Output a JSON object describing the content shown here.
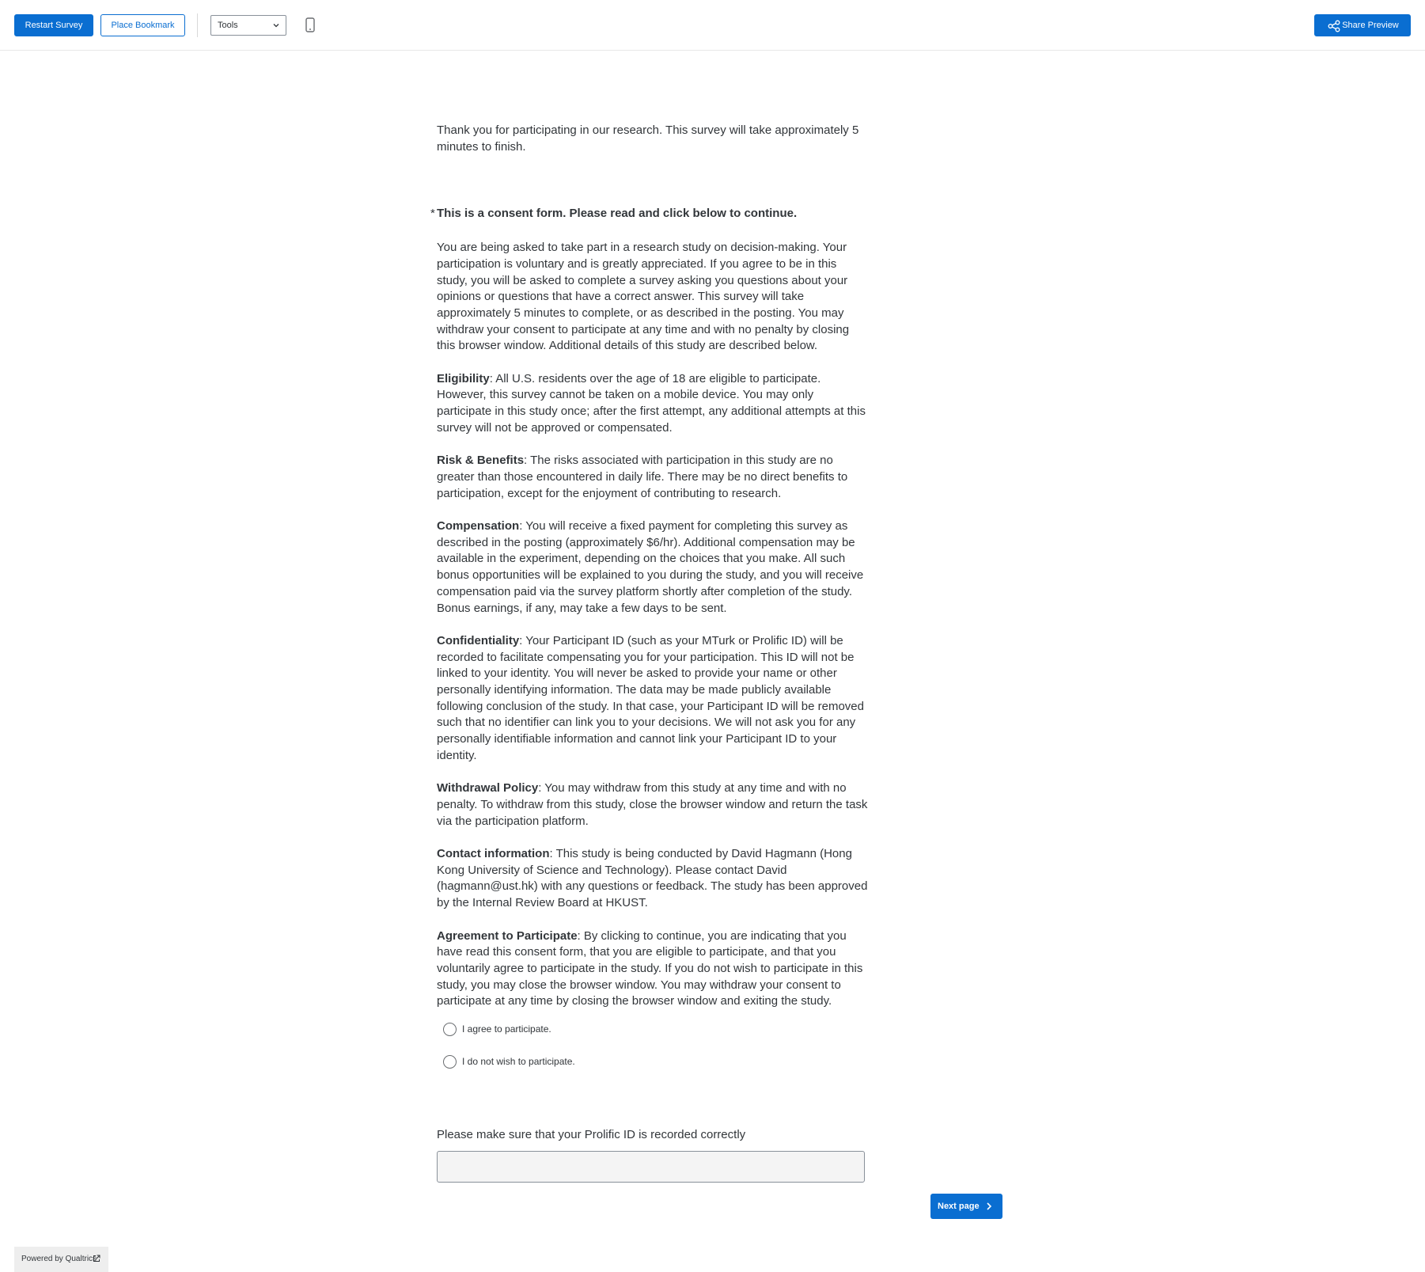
{
  "toolbar": {
    "restart_label": "Restart Survey",
    "bookmark_label": "Place Bookmark",
    "tools_selected": "Tools",
    "share_label": "Share Preview",
    "icons": {
      "mobile": "mobile-phone-icon",
      "share": "share-icon",
      "dropdown": "chevron-down-icon"
    }
  },
  "intro": {
    "text": "Thank you for participating in our research. This survey will take approximately 5 minutes to finish."
  },
  "consent": {
    "required_marker": "*",
    "title": "This is a consent form. Please read and click below to continue.",
    "paragraph_1": "You are being asked to take part in a research study on decision-making. Your participation is voluntary and is greatly appreciated. If you agree to be in this study, you will be asked to complete a survey asking you questions about your opinions or questions that have a correct answer. This survey will take approximately 5 minutes to complete, or as described in the posting. You may withdraw your consent to participate at any time and with no penalty by closing this browser window. Additional details of this study are described below.",
    "sections": [
      {
        "heading": "Eligibility",
        "text": ": All U.S. residents over the age of 18 are eligible to participate. However, this survey cannot be taken on a mobile device. You may only participate in this study once; after the first attempt, any additional attempts at this survey will not be approved or compensated."
      },
      {
        "heading": "Risk & Benefits",
        "text": ": The risks associated with participation in this study are no greater than those encountered in daily life. There may be no direct benefits to participation, except for the enjoyment of contributing to research."
      },
      {
        "heading": "Compensation",
        "text": ": You will receive a fixed payment for completing this survey as described in the posting (approximately $6/hr). Additional compensation may be available in the experiment, depending on the choices that you make. All such bonus opportunities will be explained to you during the study, and you will receive compensation paid via the survey platform shortly after completion of the study. Bonus earnings, if any, may take a few days to be sent."
      },
      {
        "heading": "Confidentiality",
        "text": ": Your Participant ID (such as your MTurk or Prolific ID) will be recorded to facilitate compensating you for your participation. This ID will not be linked to your identity. You will never be asked to provide your name or other personally identifying information. The data may be made publicly available following conclusion of the study. In that case, your Participant ID will be removed such that no identifier can link you to your decisions. We will not ask you for any personally identifiable information and cannot link your Participant ID to your identity."
      },
      {
        "heading": "Withdrawal Policy",
        "text": ": You may withdraw from this study at any time and with no penalty. To withdraw from this study, close the browser window and return the task via the participation platform."
      },
      {
        "heading": "Contact information",
        "text": ": This study is being conducted by David Hagmann (Hong Kong University of Science and Technology). Please contact David (hagmann@ust.hk) with any questions or feedback. The study has been approved by the Internal Review Board at HKUST."
      },
      {
        "heading": "Agreement to Participate",
        "text": ": By clicking to continue, you are indicating that you have read this consent form, that you are eligible to participate, and that you voluntarily agree to participate in the study. If you do not wish to participate in this study, you may close the browser window. You may withdraw your consent to participate at any time by closing the browser window and exiting the study."
      }
    ],
    "choices": [
      {
        "label": "I agree to participate.",
        "selected": false
      },
      {
        "label": "I do not wish to participate.",
        "selected": false
      }
    ]
  },
  "prolific": {
    "label": "Please make sure that your Prolific ID is recorded correctly",
    "value": ""
  },
  "footer": {
    "next_label": "Next page",
    "powered_label": "Powered by Qualtrics"
  },
  "colors": {
    "accent": "#0a6ed1",
    "text": "#32363a",
    "input_bg": "#f4f4f4",
    "badge_bg": "#eeeeee"
  }
}
